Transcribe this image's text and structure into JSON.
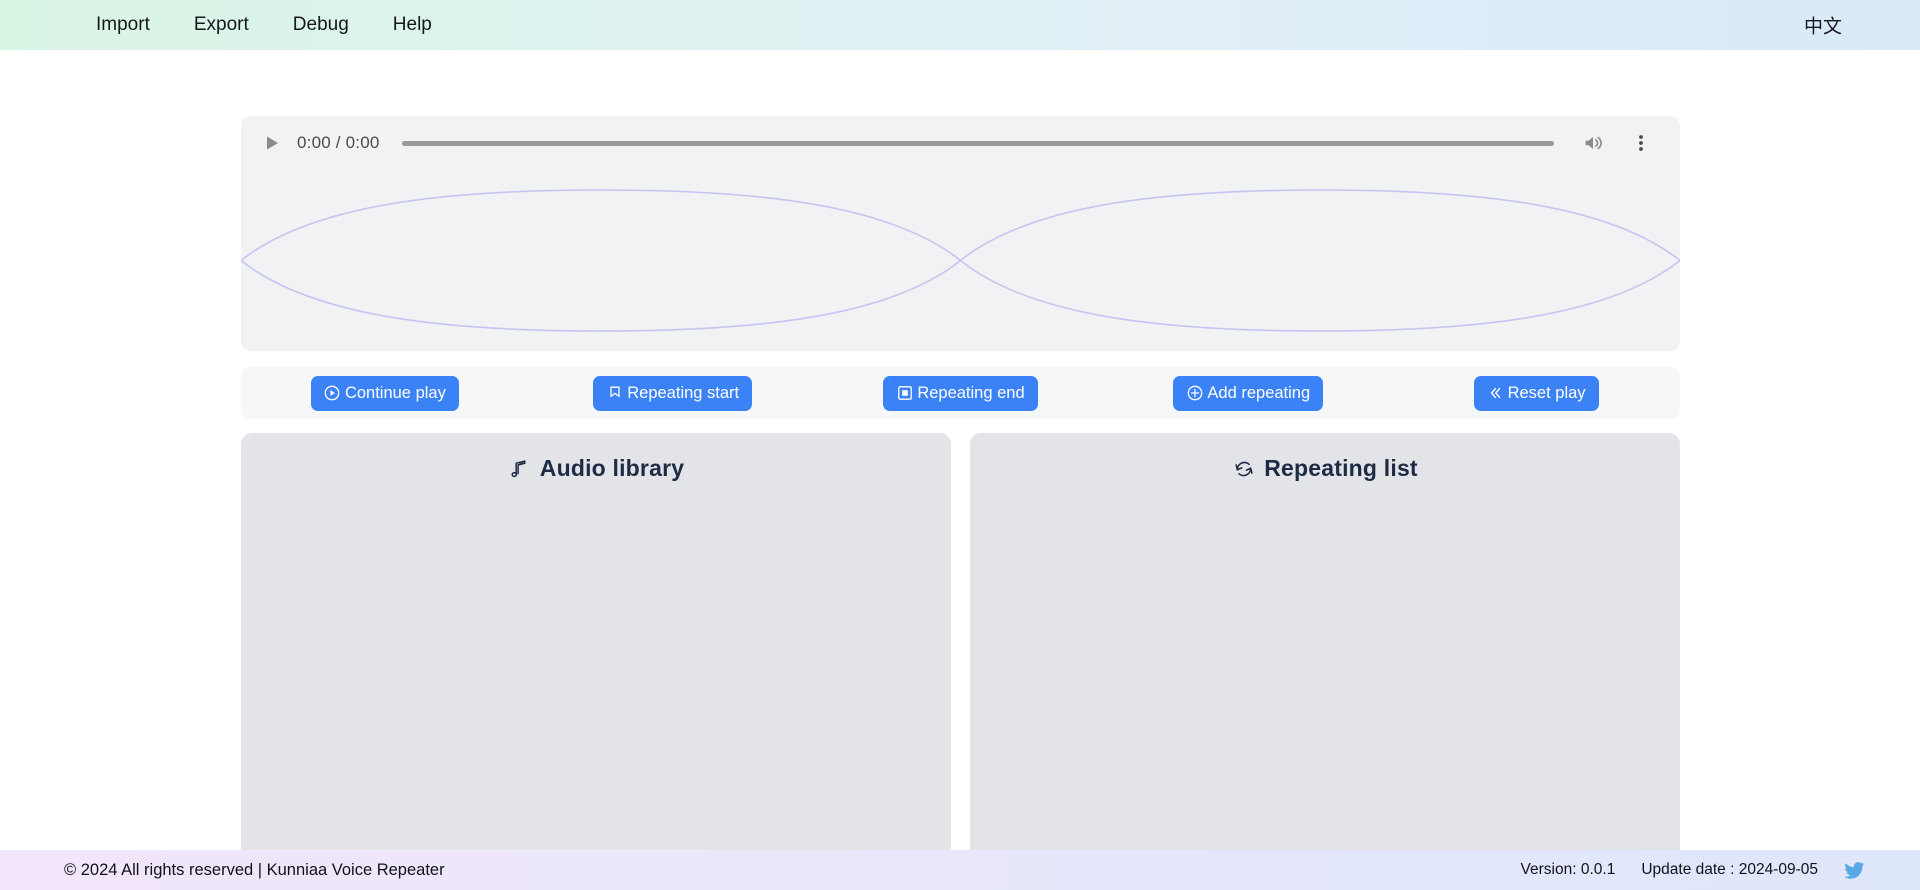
{
  "topbar": {
    "menu": [
      {
        "label": "Import",
        "name": "menu-item-import"
      },
      {
        "label": "Export",
        "name": "menu-item-export"
      },
      {
        "label": "Debug",
        "name": "menu-item-debug"
      },
      {
        "label": "Help",
        "name": "menu-item-help"
      }
    ],
    "language_toggle": "中文",
    "gradient_from": "#d9f5e4",
    "gradient_to": "#d8e9f8"
  },
  "player": {
    "play_icon": "play-triangle-icon",
    "time_display": "0:00 / 0:00",
    "current_time": "0:00",
    "duration": "0:00",
    "progress_percent": 0,
    "volume_icon": "volume-up-icon",
    "more_icon": "three-dots-vertical-icon",
    "waveform_color": "#c6c4f2",
    "panel_bg": "#f1f2f4"
  },
  "actions": {
    "accent_color": "#3b82f6",
    "buttons": [
      {
        "label": "Continue play",
        "icon": "play-circle-icon",
        "name": "continue-play-button"
      },
      {
        "label": "Repeating start",
        "icon": "bookmark-start-icon",
        "name": "repeating-start-button"
      },
      {
        "label": "Repeating end",
        "icon": "stop-square-icon",
        "name": "repeating-end-button"
      },
      {
        "label": "Add repeating",
        "icon": "plus-circle-icon",
        "name": "add-repeating-button"
      },
      {
        "label": "Reset play",
        "icon": "chevron-double-left-icon",
        "name": "reset-play-button"
      }
    ]
  },
  "panels": [
    {
      "title": "Audio library",
      "icon": "music-note-icon",
      "name": "audio-library-panel",
      "items": []
    },
    {
      "title": "Repeating list",
      "icon": "repeat-refresh-icon",
      "name": "repeating-list-panel",
      "items": []
    }
  ],
  "footer": {
    "copyright": "© 2024 All rights reserved | Kunniaa Voice Repeater",
    "version": "Version: 0.0.1",
    "update_date": "Update date : 2024-09-05",
    "social_icon": "twitter-bird-icon"
  }
}
